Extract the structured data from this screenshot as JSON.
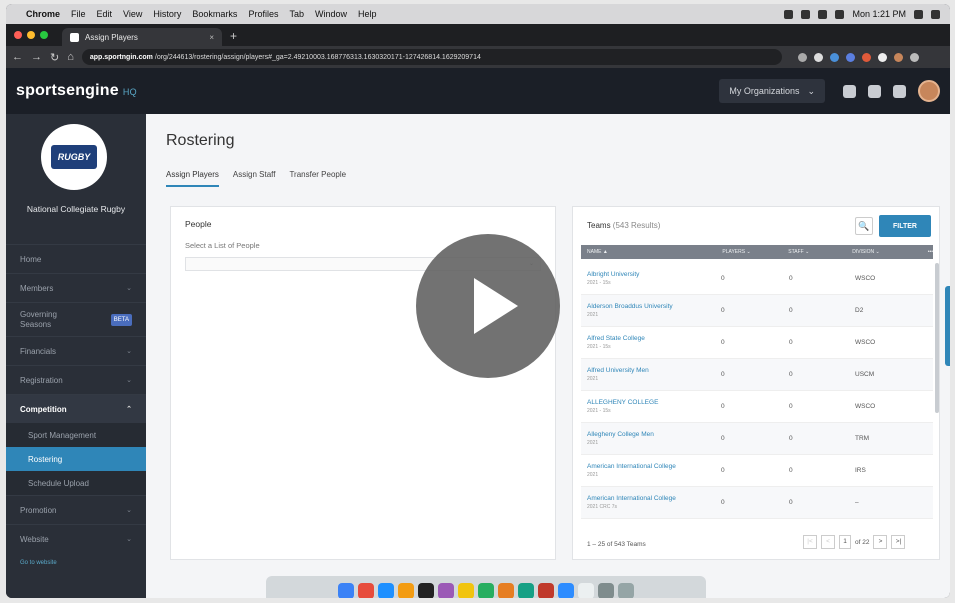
{
  "menubar": {
    "apple": "",
    "items": [
      "Chrome",
      "File",
      "Edit",
      "View",
      "History",
      "Bookmarks",
      "Profiles",
      "Tab",
      "Window",
      "Help"
    ],
    "clock": "Mon 1:21 PM"
  },
  "browser": {
    "tab_title": "Assign Players",
    "tab_close": "×",
    "new_tab": "+",
    "url_domain": "app.sportngin.com",
    "url_path": "/org/244613/rostering/assign/players#_ga=2.49210003.168776313.1630320171-127426814.1629209714"
  },
  "header": {
    "logo": "sportsengine",
    "logo_suffix": "HQ",
    "org_button": "My Organizations",
    "org_chevron": "⌄"
  },
  "sidebar": {
    "org_logo_text": "RUGBY",
    "org_name": "National Collegiate Rugby",
    "items": [
      {
        "label": "Home",
        "chev": ""
      },
      {
        "label": "Members",
        "chev": "⌄"
      },
      {
        "label": "Governing Seasons",
        "badge": "BETA"
      },
      {
        "label": "Financials",
        "chev": "⌄"
      },
      {
        "label": "Registration",
        "chev": "⌄"
      },
      {
        "label": "Competition",
        "chev": "⌃"
      }
    ],
    "sub_items": [
      "Sport Management",
      "Rostering",
      "Schedule Upload"
    ],
    "after_items": [
      {
        "label": "Promotion",
        "chev": "⌄"
      },
      {
        "label": "Website",
        "chev": "⌄"
      }
    ],
    "goto": "Go to website"
  },
  "main": {
    "title": "Rostering",
    "tabs": [
      "Assign Players",
      "Assign Staff",
      "Transfer People"
    ],
    "people": {
      "heading": "People",
      "select_label": "Select a List of People",
      "select_arrow": "⌄"
    },
    "teams": {
      "heading": "Teams",
      "count": "(543 Results)",
      "search_icon": "🔍",
      "filter": "FILTER",
      "columns": [
        "NAME ▲",
        "PLAYERS ⌄",
        "STAFF ⌄",
        "DIVISION ⌄",
        "•••"
      ],
      "rows": [
        {
          "name": "Albright University",
          "year": "2021 - 15s",
          "players": "0",
          "staff": "0",
          "division": "WSCO"
        },
        {
          "name": "Alderson Broaddus University",
          "year": "2021",
          "players": "0",
          "staff": "0",
          "division": "D2"
        },
        {
          "name": "Alfred State College",
          "year": "2021 - 15s",
          "players": "0",
          "staff": "0",
          "division": "WSCO"
        },
        {
          "name": "Alfred University Men",
          "year": "2021",
          "players": "0",
          "staff": "0",
          "division": "USCM"
        },
        {
          "name": "ALLEGHENY COLLEGE",
          "year": "2021 - 15s",
          "players": "0",
          "staff": "0",
          "division": "WSCO"
        },
        {
          "name": "Allegheny College Men",
          "year": "2021",
          "players": "0",
          "staff": "0",
          "division": "TRM"
        },
        {
          "name": "American International College",
          "year": "2021",
          "players": "0",
          "staff": "0",
          "division": "IRS"
        },
        {
          "name": "American International College",
          "year": "2021 CRC 7s",
          "players": "0",
          "staff": "0",
          "division": "–"
        }
      ],
      "footer": "1 – 25 of 543 Teams",
      "page": "1",
      "page_of": "of 22",
      "pager": {
        "first": "|<",
        "prev": "<",
        "next": ">",
        "last": ">|"
      }
    }
  },
  "colors": {
    "accent": "#2f86b8",
    "sidebar_bg": "#2a2f38",
    "header_bg": "#1b1f27"
  }
}
